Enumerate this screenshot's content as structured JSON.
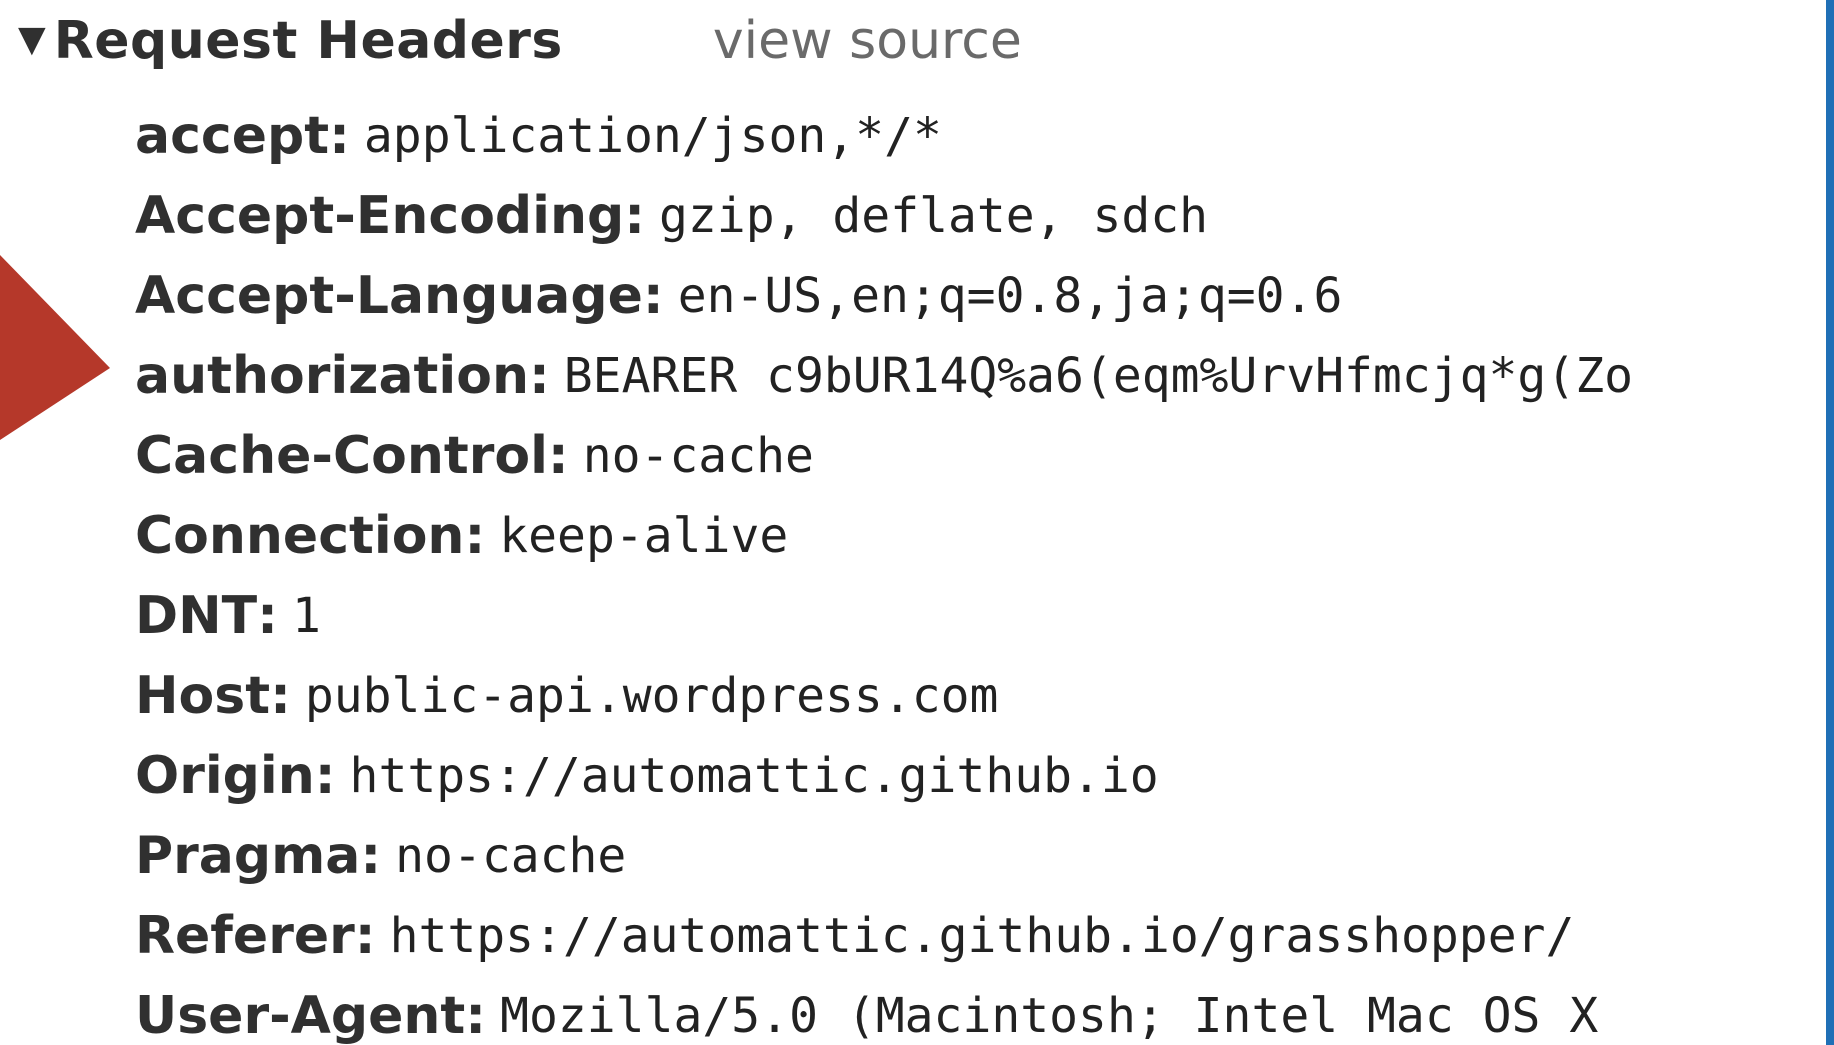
{
  "section": {
    "title": "Request Headers",
    "view_source_label": "view source",
    "toggle_icon": "disclosure-triangle-down"
  },
  "headers": [
    {
      "name": "accept",
      "value": "application/json,*/*"
    },
    {
      "name": "Accept-Encoding",
      "value": "gzip, deflate, sdch"
    },
    {
      "name": "Accept-Language",
      "value": "en-US,en;q=0.8,ja;q=0.6"
    },
    {
      "name": "authorization",
      "value": "BEARER c9bUR14Q%a6(eqm%UrvHfmcjq*g(Zo"
    },
    {
      "name": "Cache-Control",
      "value": "no-cache"
    },
    {
      "name": "Connection",
      "value": "keep-alive"
    },
    {
      "name": "DNT",
      "value": "1"
    },
    {
      "name": "Host",
      "value": "public-api.wordpress.com"
    },
    {
      "name": "Origin",
      "value": "https://automattic.github.io"
    },
    {
      "name": "Pragma",
      "value": "no-cache"
    },
    {
      "name": "Referer",
      "value": "https://automattic.github.io/grasshopper/"
    },
    {
      "name": "User-Agent",
      "value": "Mozilla/5.0 (Macintosh; Intel Mac OS X"
    }
  ],
  "colors": {
    "arrow": "#b5382a",
    "edge_bar": "#1f6fb6"
  }
}
